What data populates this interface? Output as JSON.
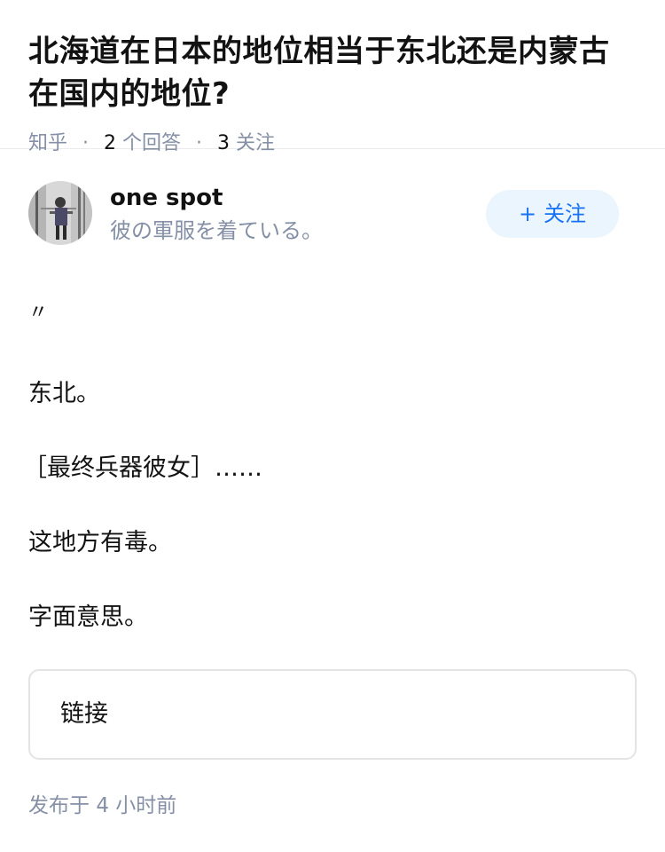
{
  "question": {
    "title": "北海道在日本的地位相当于东北还是内蒙古在国内的地位?",
    "source": "知乎",
    "answer_count": "2",
    "answer_label": "个回答",
    "follower_count": "3",
    "follower_label": "关注"
  },
  "author": {
    "name": "one spot",
    "bio": "彼の軍服を着ている。",
    "follow_label": "关注",
    "follow_icon": "plus-icon"
  },
  "answer": {
    "quote_mark": "〃",
    "paragraphs": [
      "东北。",
      "［最终兵器彼女］……",
      "这地方有毒。",
      "字面意思。"
    ],
    "link_label": "链接",
    "publish_prefix": "发布于",
    "publish_time": "4 小时前"
  },
  "colors": {
    "accent": "#1772f6",
    "follow_bg": "#ebf5fd",
    "meta_gray": "#8590a6",
    "text": "#121212"
  }
}
